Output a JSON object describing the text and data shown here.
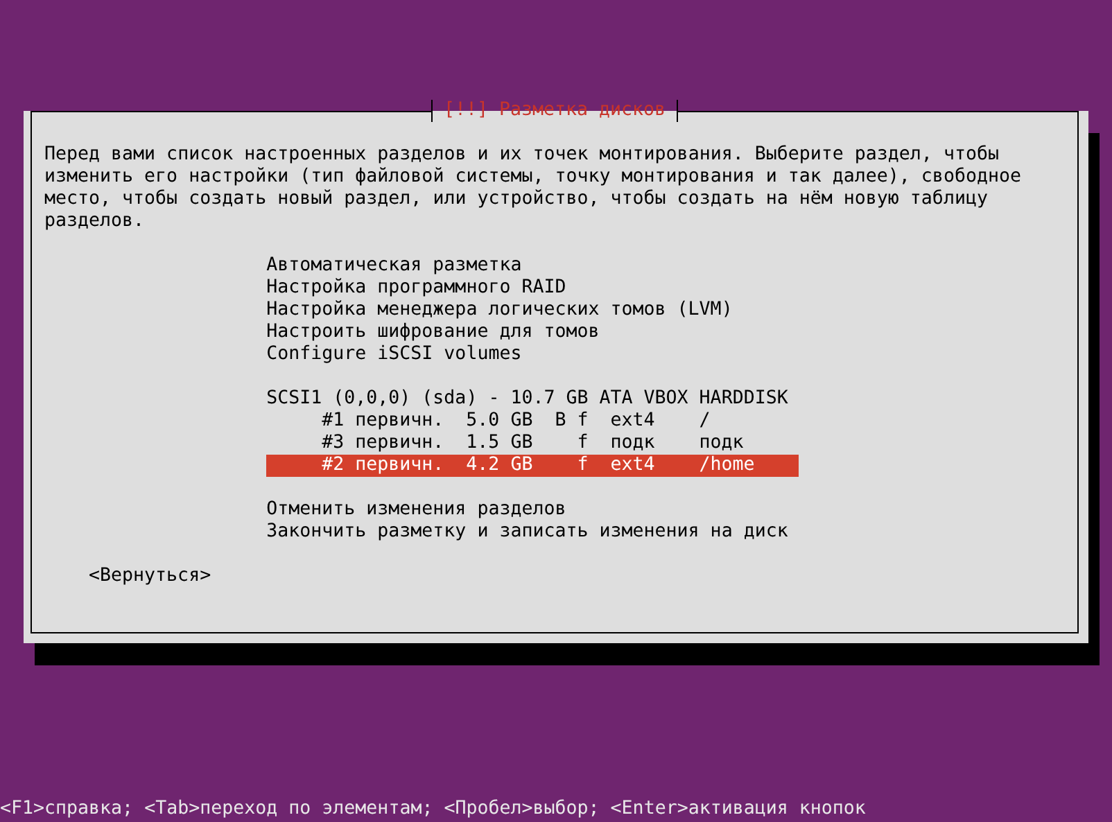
{
  "dialog": {
    "title": "[!!] Разметка дисков",
    "description": "Перед вами список настроенных разделов и их точек монтирования. Выберите раздел, чтобы изменить его настройки (тип файловой системы, точку монтирования и так далее), свободное место, чтобы создать новый раздел, или устройство, чтобы создать на нём новую таблицу разделов.",
    "menu": {
      "options": [
        {
          "label": "Автоматическая разметка",
          "selected": false
        },
        {
          "label": "Настройка программного RAID",
          "selected": false
        },
        {
          "label": "Настройка менеджера логических томов (LVM)",
          "selected": false
        },
        {
          "label": "Настроить шифрование для томов",
          "selected": false
        },
        {
          "label": "Configure iSCSI volumes",
          "selected": false
        }
      ],
      "disk": {
        "label": "SCSI1 (0,0,0) (sda) - 10.7 GB ATA VBOX HARDDISK",
        "selected": false,
        "partitions": [
          {
            "number": "#1",
            "type": "первичн.",
            "size": "5.0 GB",
            "bootable": "B",
            "format": "f",
            "filesystem": "ext4",
            "mount": "/",
            "selected": false
          },
          {
            "number": "#3",
            "type": "первичн.",
            "size": "1.5 GB",
            "format": "f",
            "filesystem": "подк",
            "mount": "подк",
            "selected": false
          },
          {
            "number": "#2",
            "type": "первичн.",
            "size": "4.2 GB",
            "format": "f",
            "filesystem": "ext4",
            "mount": "/home",
            "selected": true
          }
        ]
      },
      "actions": [
        {
          "label": "Отменить изменения разделов",
          "selected": false
        },
        {
          "label": "Закончить разметку и записать изменения на диск",
          "selected": false
        }
      ]
    },
    "back_button": "<Вернуться>"
  },
  "status_bar": "<F1>справка; <Tab>переход по элементам; <Пробел>выбор; <Enter>активация кнопок"
}
